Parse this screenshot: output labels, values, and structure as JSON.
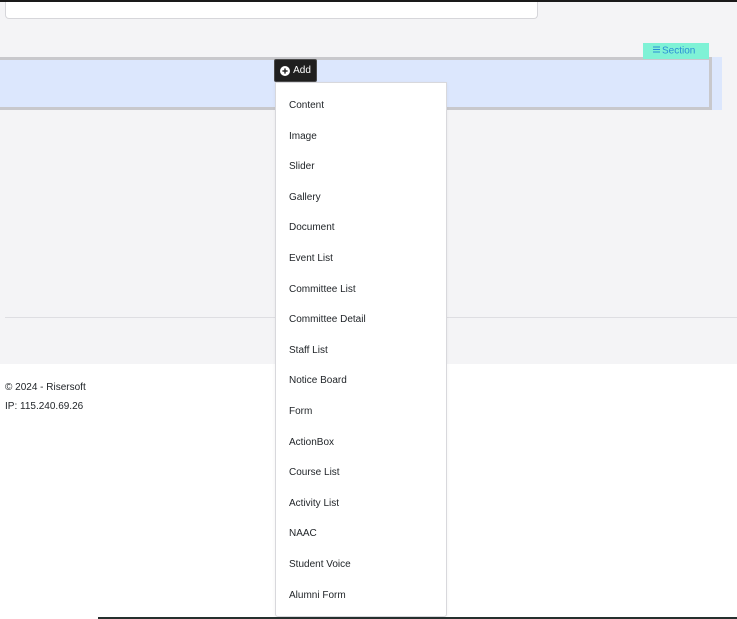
{
  "section_badge": {
    "label": "Section",
    "icon": "list-icon"
  },
  "add_button": {
    "label": "Add",
    "icon": "plus-circle-icon"
  },
  "dropdown": {
    "items": [
      "Content",
      "Image",
      "Slider",
      "Gallery",
      "Document",
      "Event List",
      "Committee List",
      "Committee Detail",
      "Staff List",
      "Notice Board",
      "Form",
      "ActionBox",
      "Course List",
      "Activity List",
      "NAAC",
      "Student Voice",
      "Alumni Form"
    ]
  },
  "footer": {
    "copyright": "© 2024 - Risersoft",
    "ip": "IP: 115.240.69.26"
  },
  "colors": {
    "section_bar": "#dce7fd",
    "section_badge_bg": "#7ff2d6",
    "section_badge_text": "#2b8fd6",
    "add_button_bg": "#1f1f1f"
  }
}
